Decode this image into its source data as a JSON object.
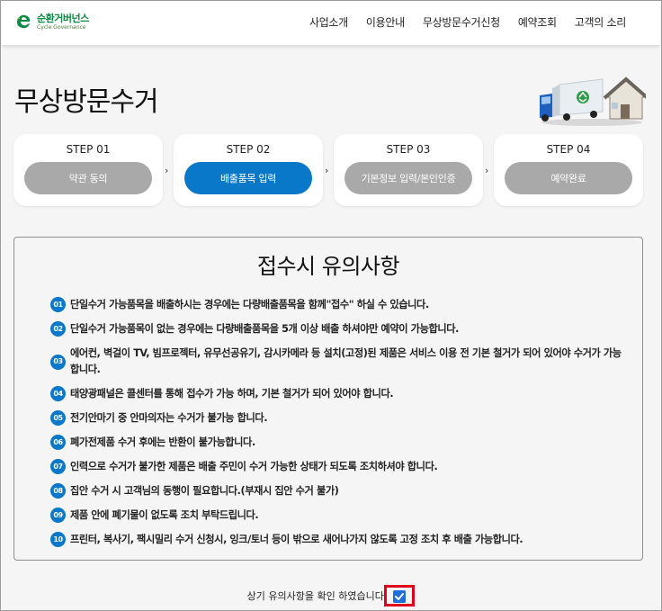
{
  "header": {
    "logo_korean": "순환거버넌스",
    "logo_english": "Cycle Governance",
    "nav": [
      "사업소개",
      "이용안내",
      "무상방문수거신청",
      "예약조회",
      "고객의 소리"
    ]
  },
  "page": {
    "title": "무상방문수거"
  },
  "steps": [
    {
      "label": "STEP 01",
      "button": "약관 동의",
      "active": false
    },
    {
      "label": "STEP 02",
      "button": "배출품목 입력",
      "active": true
    },
    {
      "label": "STEP 03",
      "button": "기본정보 입력/본인인증",
      "active": false
    },
    {
      "label": "STEP 04",
      "button": "예약완료",
      "active": false
    }
  ],
  "step_arrow": "›",
  "notice": {
    "title": "접수시 유의사항",
    "items": [
      {
        "num": "01",
        "text": "단일수거 가능품목을 배출하시는 경우에는 다량배출품목을 함께\"접수\" 하실 수 있습니다."
      },
      {
        "num": "02",
        "text": "단일수거 가능품목이 없는 경우에는 다량배출품목을 5개 이상 배출 하셔야만 예약이 가능합니다."
      },
      {
        "num": "03",
        "text": "에어컨, 벽걸이 TV, 빔프로젝터, 유무선공유기, 감시카메라 등 설치(고정)된 제품은 서비스 이용 전 기본 철거가 되어 있어야 수거가 가능합니다."
      },
      {
        "num": "04",
        "text": "태양광패널은 콜센터를 통해 접수가 가능 하며, 기본 철거가 되어 있어야 합니다."
      },
      {
        "num": "05",
        "text": "전기안마기 중 안마의자는 수거가 불가능 합니다."
      },
      {
        "num": "06",
        "text": "폐가전제품 수거 후에는 반환이 불가능합니다."
      },
      {
        "num": "07",
        "text": "인력으로 수거가 불가한 제품은 배출 주민이 수거 가능한 상태가 되도록 조치하셔야 합니다."
      },
      {
        "num": "08",
        "text": "집안 수거 시 고객님의 동행이 필요합니다.(부재시 집안 수거 불가)"
      },
      {
        "num": "09",
        "text": "제품 안에 폐기물이 없도록 조치 부탁드립니다."
      },
      {
        "num": "10",
        "text": "프린터, 복사기, 팩시밀리 수거 신청시, 잉크/토너 등이 밖으로 새어나가지 않도록 고정 조치 후 배출 가능합니다."
      }
    ]
  },
  "confirm": {
    "label": "상기 유의사항을 확인 하였습니다.",
    "checked": true
  },
  "colors": {
    "accent": "#0a78c8",
    "inactive_step": "#a9a9a9",
    "highlight_border": "#e0001b",
    "checkbox": "#1e6fd9",
    "logo_green": "#0d8a43"
  },
  "icons": {
    "logo": "recycle-e-logo-icon",
    "hero": "recycling-truck-and-house-icon",
    "checkbox": "checkmark-icon"
  }
}
